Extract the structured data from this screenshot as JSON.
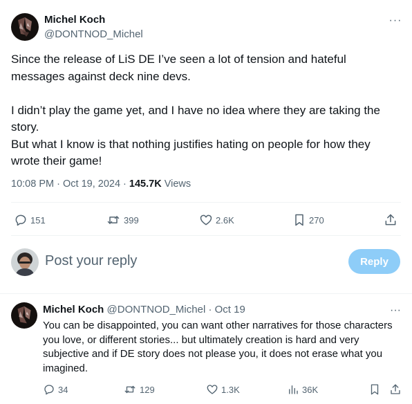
{
  "post": {
    "author_name": "Michel Koch",
    "author_handle": "@DONTNOD_Michel",
    "more_label": "···",
    "paragraphs": [
      "Since the release of LiS DE I’ve seen a lot of tension and hateful messages against deck nine devs.",
      "I didn’t play the game yet, and I have no idea where they are taking the story.\nBut what I know is that nothing justifies hating on people for how they wrote their game!"
    ],
    "time": "10:08 PM",
    "date": "Oct 19, 2024",
    "separator": "·",
    "views_count": "145.7K",
    "views_label": "Views",
    "actions": {
      "replies": "151",
      "reposts": "399",
      "likes": "2.6K",
      "bookmarks": "270"
    }
  },
  "composer": {
    "placeholder": "Post your reply",
    "button_label": "Reply"
  },
  "reply": {
    "author_name": "Michel Koch",
    "author_handle": "@DONTNOD_Michel",
    "separator": "·",
    "date": "Oct 19",
    "more_label": "···",
    "text": "You can be disappointed, you can want other narratives for those characters you love, or different stories... but ultimately creation is hard and very subjective and if DE story does not please you, it does not erase what you imagined.",
    "actions": {
      "replies": "34",
      "reposts": "129",
      "likes": "1.3K",
      "views": "36K"
    }
  },
  "colors": {
    "text_primary": "#0f1419",
    "text_secondary": "#536471",
    "reply_button_disabled": "#8ecdf8",
    "divider": "#eff3f4"
  },
  "icons": [
    "comment-icon",
    "repost-icon",
    "heart-icon",
    "bookmark-icon",
    "share-icon",
    "views-chart-icon",
    "more-icon"
  ]
}
